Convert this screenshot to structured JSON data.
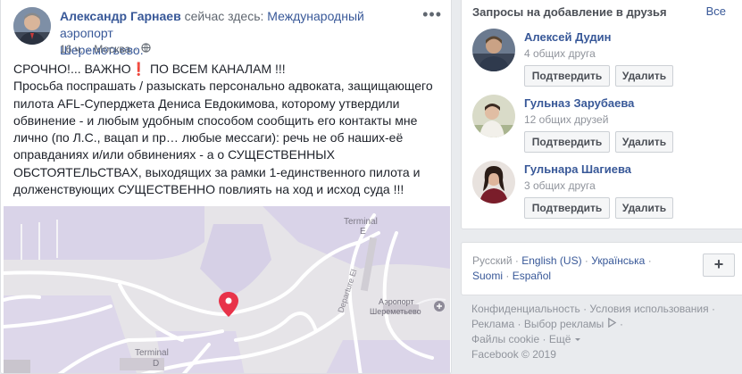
{
  "post": {
    "author": "Александр Гарнаев",
    "status": "сейчас здесь:",
    "place_line1": "Международный аэропорт",
    "place_line2": "Шереметьево.",
    "time": "16 ч.",
    "sep": "·",
    "location": "Москва",
    "sep2": "·",
    "more_label": "•••",
    "text": "СРОЧНО!... ВАЖНО❗ ПО ВСЕМ КАНАЛАМ !!!\nПросьба поспрашать / разыскать персонально адвоката, защищающего пилота AFL-Суперджета Дениса Евдокимова, которому утвердили обвинение - и любым удобным способом сообщить его контакты мне лично (по Л.С., вацап и пр… любые мессаги): речь не об наших-её оправданиях и/или обвинениях - а о СУЩЕСТВЕННЫХ ОБСТОЯТЕЛЬСТВАХ, выходящих за рамки 1-единственного пилота и долженствующих СУЩЕСТВЕННО повлиять на ход и исход суда !!!",
    "map": {
      "terminal_e": "Terminal",
      "terminal_e_letter": "E",
      "terminal_d": "Terminal",
      "terminal_d_letter": "D",
      "departure": "Departure El",
      "airport_name_1": "Аэропорт",
      "airport_name_2": "Шереметьево",
      "pin_color": "#e8334a"
    }
  },
  "requests": {
    "title": "Запросы на добавление в друзья",
    "all_label": "Все",
    "confirm_label": "Подтвердить",
    "delete_label": "Удалить",
    "items": [
      {
        "name": "Алексей Дудин",
        "mutual": "4 общих друга"
      },
      {
        "name": "Гульназ Зарубаева",
        "mutual": "12 общих друзей"
      },
      {
        "name": "Гульнара Шагиева",
        "mutual": "3 общих друга"
      }
    ]
  },
  "languages": {
    "current": "Русский",
    "items": [
      "English (US)",
      "Українська",
      "Suomi",
      "Español"
    ],
    "sep": "·",
    "plus_label": "+"
  },
  "footer": {
    "privacy": "Конфиденциальность",
    "terms": "Условия использования",
    "ads": "Реклама",
    "ad_choices": "Выбор рекламы",
    "cookies": "Файлы cookie",
    "more": "Ещё",
    "sep": "·",
    "copyright": "Facebook © 2019"
  },
  "colors": {
    "link": "#385898",
    "muted": "#90949c",
    "page_bg": "#e9ebee"
  }
}
